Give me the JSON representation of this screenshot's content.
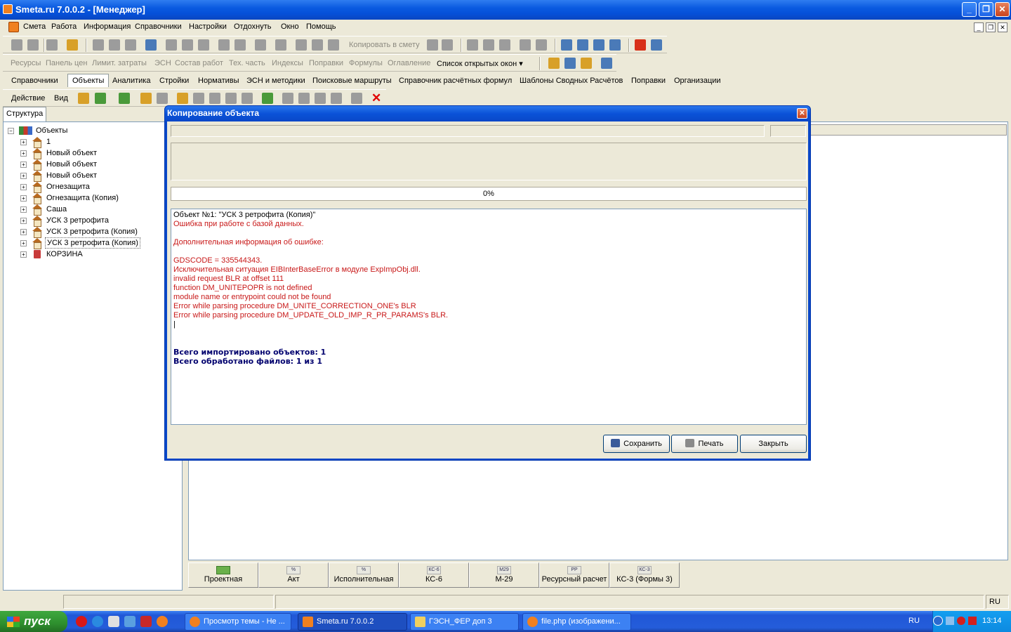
{
  "app": {
    "title": "Smeta.ru  7.0.0.2   - [Менеджер]",
    "window_controls": {
      "minimize": "_",
      "restore": "❐",
      "close": "✕"
    }
  },
  "menu": {
    "items": [
      "Смета",
      "Работа",
      "Информация",
      "Справочники",
      "Настройки",
      "Отдохнуть",
      "Окно",
      "Помощь"
    ]
  },
  "toolbar1": {
    "copy_to_estimate": "Копировать в смету"
  },
  "toolbar2": {
    "items": [
      "Ресурсы",
      "Панель цен",
      "Лимит. затраты",
      "ЭСН",
      "Состав работ",
      "Тех. часть",
      "Индексы",
      "Поправки",
      "Формулы",
      "Оглавление"
    ],
    "open_windows": "Список открытых окон ▾"
  },
  "tabs": {
    "items": [
      "Справочники",
      "Объекты",
      "Аналитика",
      "Стройки",
      "Нормативы",
      "ЭСН и методики",
      "Поисковые маршруты",
      "Справочник расчётных формул",
      "Шаблоны Сводных Расчётов",
      "Поправки",
      "Организации"
    ],
    "active": "Объекты"
  },
  "actionbar": {
    "action": "Действие",
    "view": "Вид"
  },
  "structure": {
    "tab_label": "Структура",
    "root": "Объекты",
    "nodes": [
      "1",
      "Новый объект",
      "Новый объект",
      "Новый объект",
      "Огнезащита",
      "Огнезащита (Копия)",
      "Саша",
      "УСК 3 ретрофита",
      "УСК 3 ретрофита (Копия)",
      "УСК 3 ретрофита (Копия)",
      "КОРЗИНА"
    ],
    "selected_index": 9
  },
  "bottom_tabs": [
    {
      "icon": "",
      "label": "Проектная"
    },
    {
      "icon": "%",
      "label": "Акт"
    },
    {
      "icon": "%",
      "label": "Исполнительная"
    },
    {
      "icon": "КС-6",
      "label": "КС-6"
    },
    {
      "icon": "М29",
      "label": "М-29"
    },
    {
      "icon": "РР",
      "label": "Ресурсный расчет"
    },
    {
      "icon": "КС-3",
      "label": "КС-3 (Формы 3)"
    }
  ],
  "statusbar": {
    "lang": "RU"
  },
  "dialog": {
    "title": "Копирование объекта",
    "close": "✕",
    "progress_text": "0%",
    "progress_value": 0,
    "log": [
      {
        "text": "Объект №1: \"УСК 3 ретрофита (Копия)\"",
        "style": "normal"
      },
      {
        "text": "Ошибка при работе с базой данных.",
        "style": "err"
      },
      {
        "text": "",
        "style": "normal"
      },
      {
        "text": "Дополнительная информация об ошибке:",
        "style": "err"
      },
      {
        "text": "",
        "style": "normal"
      },
      {
        "text": "GDSCODE = 335544343.",
        "style": "err"
      },
      {
        "text": "Исключительная ситуация EIBInterBaseError в модуле ExpImpObj.dll.",
        "style": "err"
      },
      {
        "text": "invalid request BLR at offset 111",
        "style": "err"
      },
      {
        "text": "function DM_UNITEPOPR is not defined",
        "style": "err"
      },
      {
        "text": "module name or entrypoint could not be found",
        "style": "err"
      },
      {
        "text": "Error while parsing procedure DM_UNITE_CORRECTION_ONE's BLR",
        "style": "err"
      },
      {
        "text": "Error while parsing procedure DM_UPDATE_OLD_IMP_R_PR_PARAMS's BLR.",
        "style": "err"
      },
      {
        "text": "|",
        "style": "normal"
      },
      {
        "text": "",
        "style": "normal"
      },
      {
        "text": "",
        "style": "normal"
      },
      {
        "text": "Всего импортировано объектов: 1",
        "style": "bold"
      },
      {
        "text": "Всего обработано файлов: 1 из 1",
        "style": "bold"
      }
    ],
    "buttons": {
      "save": "Сохранить",
      "print": "Печать",
      "close": "Закрыть"
    }
  },
  "taskbar": {
    "start": "пуск",
    "windows": [
      {
        "label": "Просмотр темы - Не ...",
        "active": false
      },
      {
        "label": "Smeta.ru  7.0.0.2",
        "active": true
      },
      {
        "label": "ГЭСН_ФЕР доп 3",
        "active": false
      },
      {
        "label": "file.php (изображени...",
        "active": false
      }
    ],
    "lang": "RU",
    "clock": "13:14"
  },
  "colors": {
    "error_text": "#c81818",
    "summary_text": "#00006e",
    "title_blue": "#0a52d8"
  }
}
